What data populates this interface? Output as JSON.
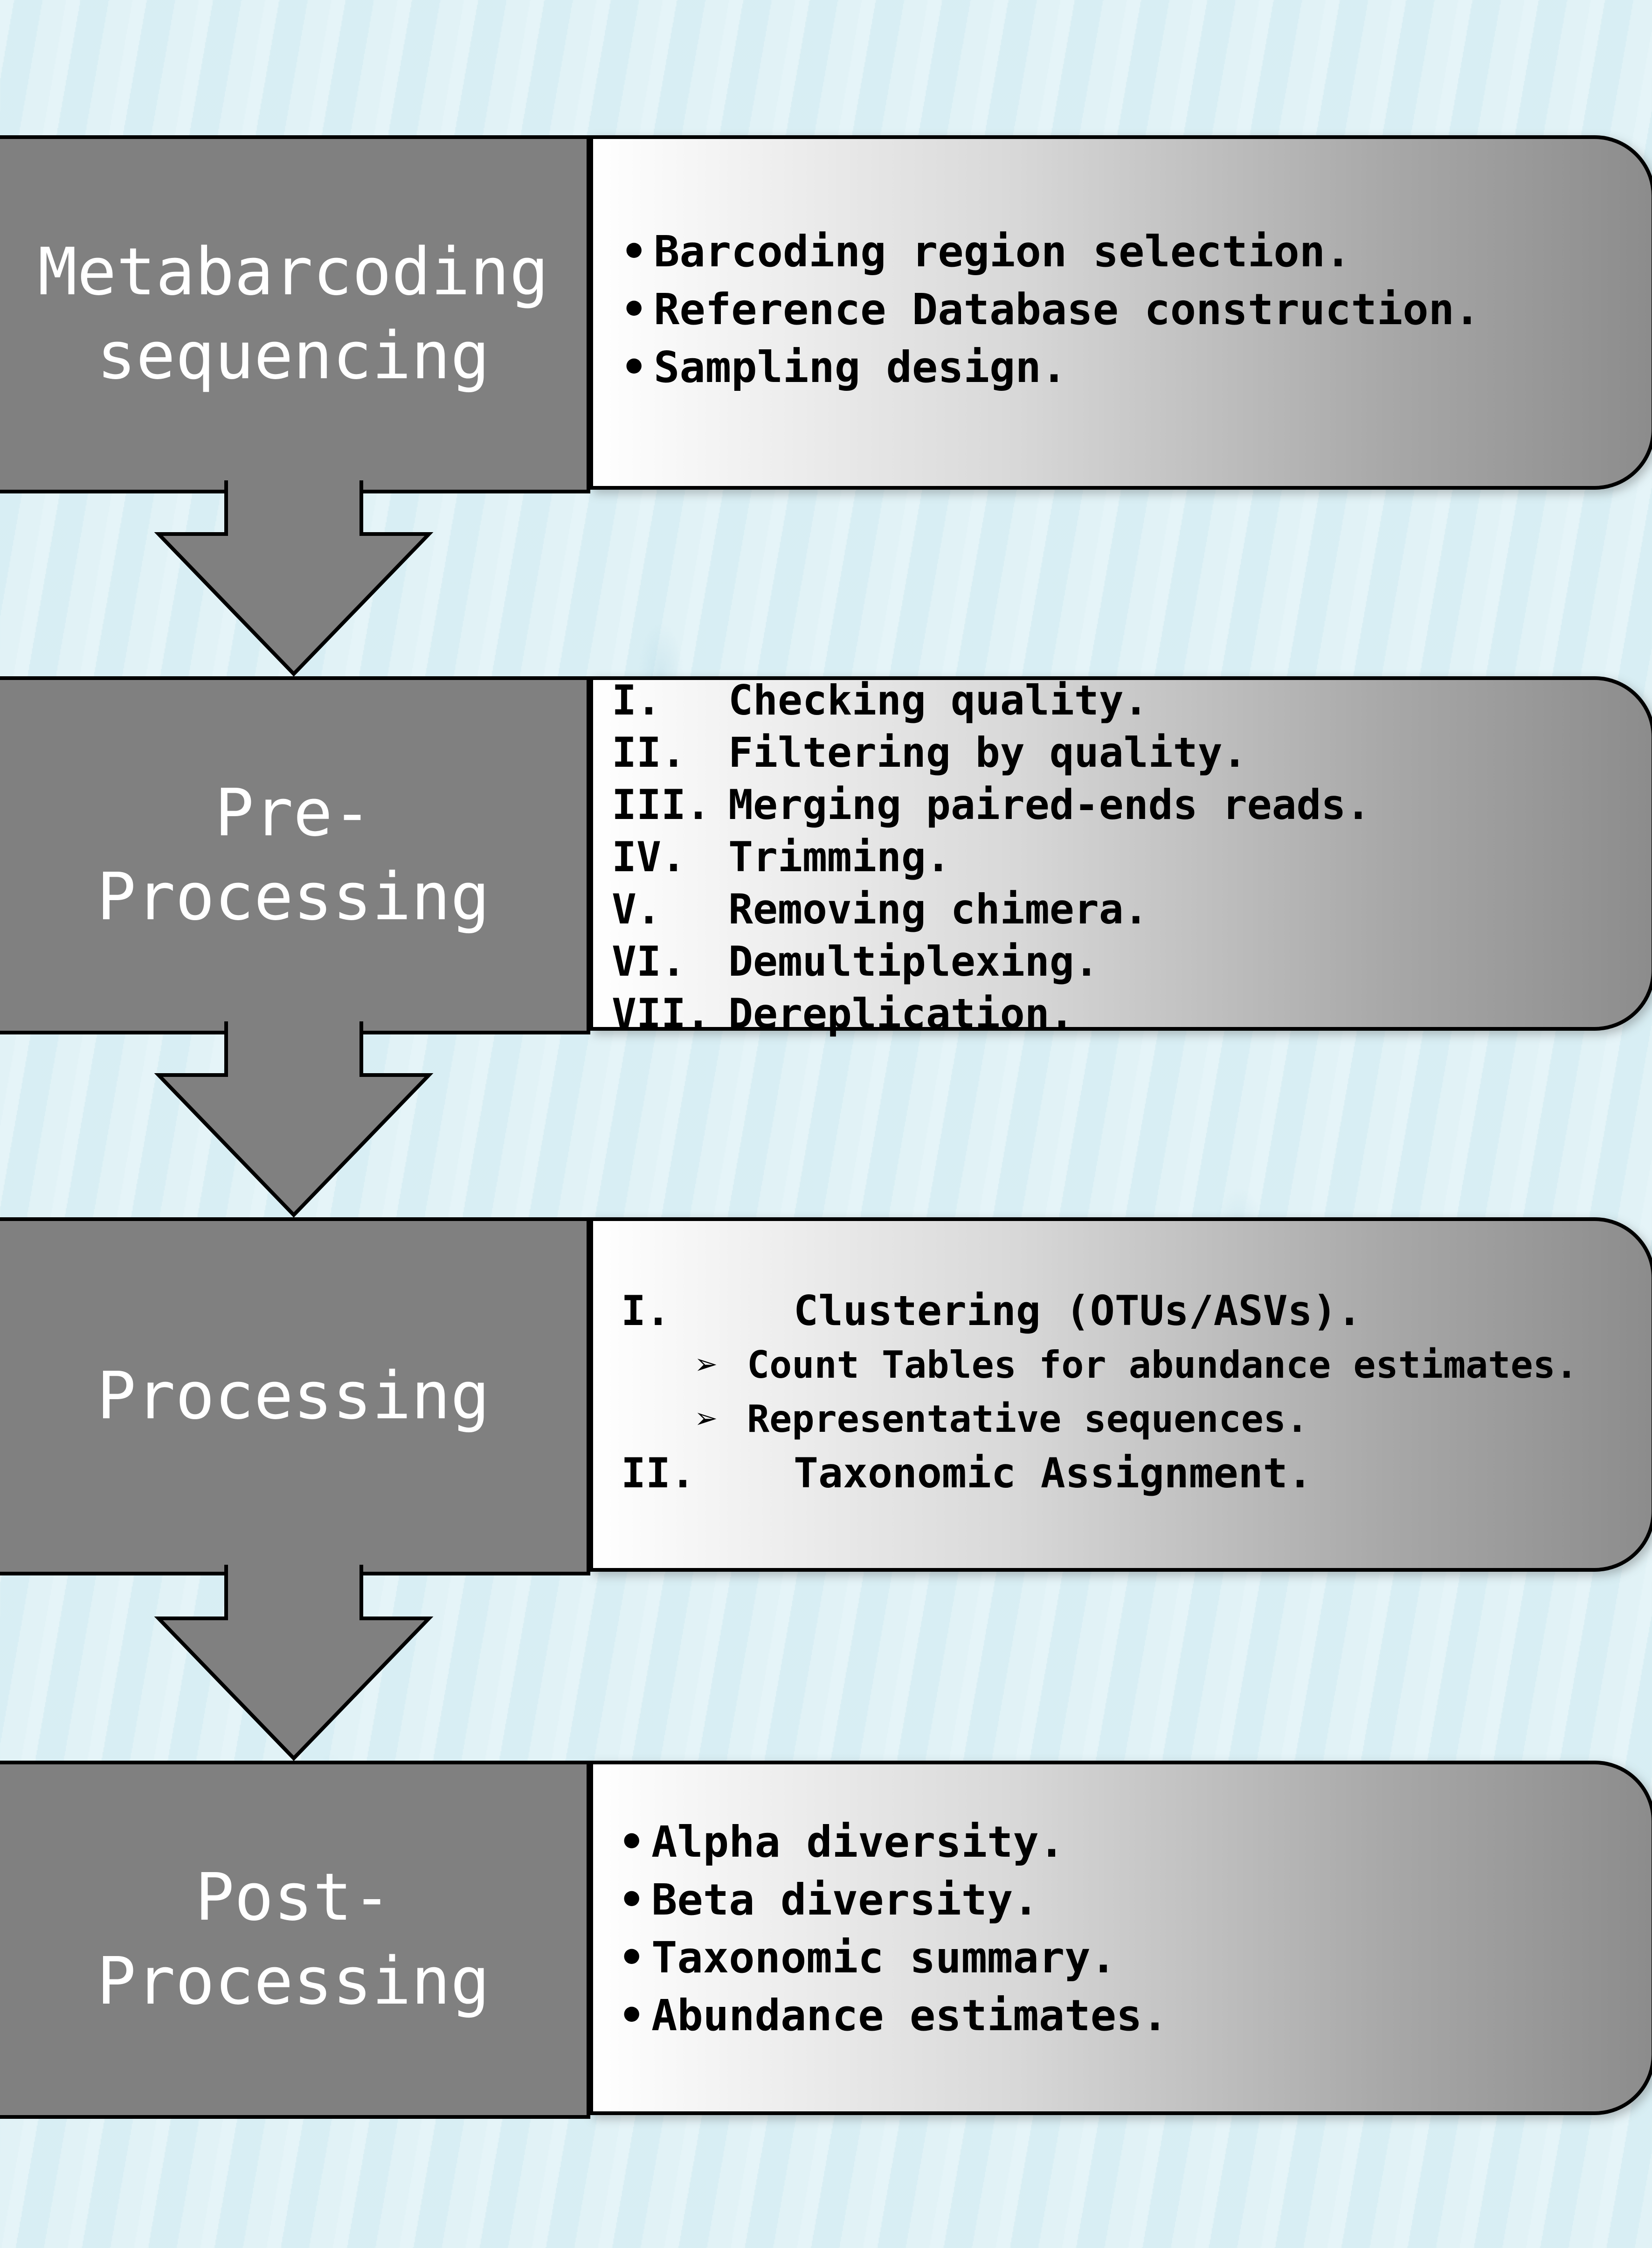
{
  "steps": [
    {
      "title": "Metabarcoding\nsequencing",
      "list_type": "bullets",
      "items": [
        {
          "marker": "•",
          "text": "Barcoding region selection."
        },
        {
          "marker": "•",
          "text": "Reference Database construction."
        },
        {
          "marker": "•",
          "text": "Sampling design."
        }
      ]
    },
    {
      "title": "Pre-\nProcessing",
      "list_type": "roman",
      "items": [
        {
          "marker": "I.",
          "text": "Checking quality."
        },
        {
          "marker": "II.",
          "text": "Filtering by quality."
        },
        {
          "marker": "III.",
          "text": "Merging paired-ends reads."
        },
        {
          "marker": "IV.",
          "text": "Trimming."
        },
        {
          "marker": "V.",
          "text": "Removing chimera."
        },
        {
          "marker": "VI.",
          "text": "Demultiplexing."
        },
        {
          "marker": "VII.",
          "text": "Dereplication."
        }
      ]
    },
    {
      "title": "Processing",
      "list_type": "roman-nested",
      "items": [
        {
          "marker": "I.",
          "text": "Clustering (OTUs/ASVs).",
          "level": 0
        },
        {
          "marker": "➢",
          "text": "Count Tables for abundance estimates.",
          "level": 1
        },
        {
          "marker": "➢",
          "text": "Representative sequences.",
          "level": 1
        },
        {
          "marker": "II.",
          "text": "Taxonomic Assignment.",
          "level": 0
        }
      ]
    },
    {
      "title": "Post-\nProcessing",
      "list_type": "bullets",
      "items": [
        {
          "marker": "•",
          "text": "Alpha diversity."
        },
        {
          "marker": "•",
          "text": "Beta diversity."
        },
        {
          "marker": "•",
          "text": "Taxonomic summary."
        },
        {
          "marker": "•",
          "text": "Abundance estimates."
        }
      ]
    }
  ],
  "colors": {
    "label_box": "#808080",
    "label_text": "#ffffff",
    "border": "#000000",
    "background": "#dcf0f5"
  }
}
